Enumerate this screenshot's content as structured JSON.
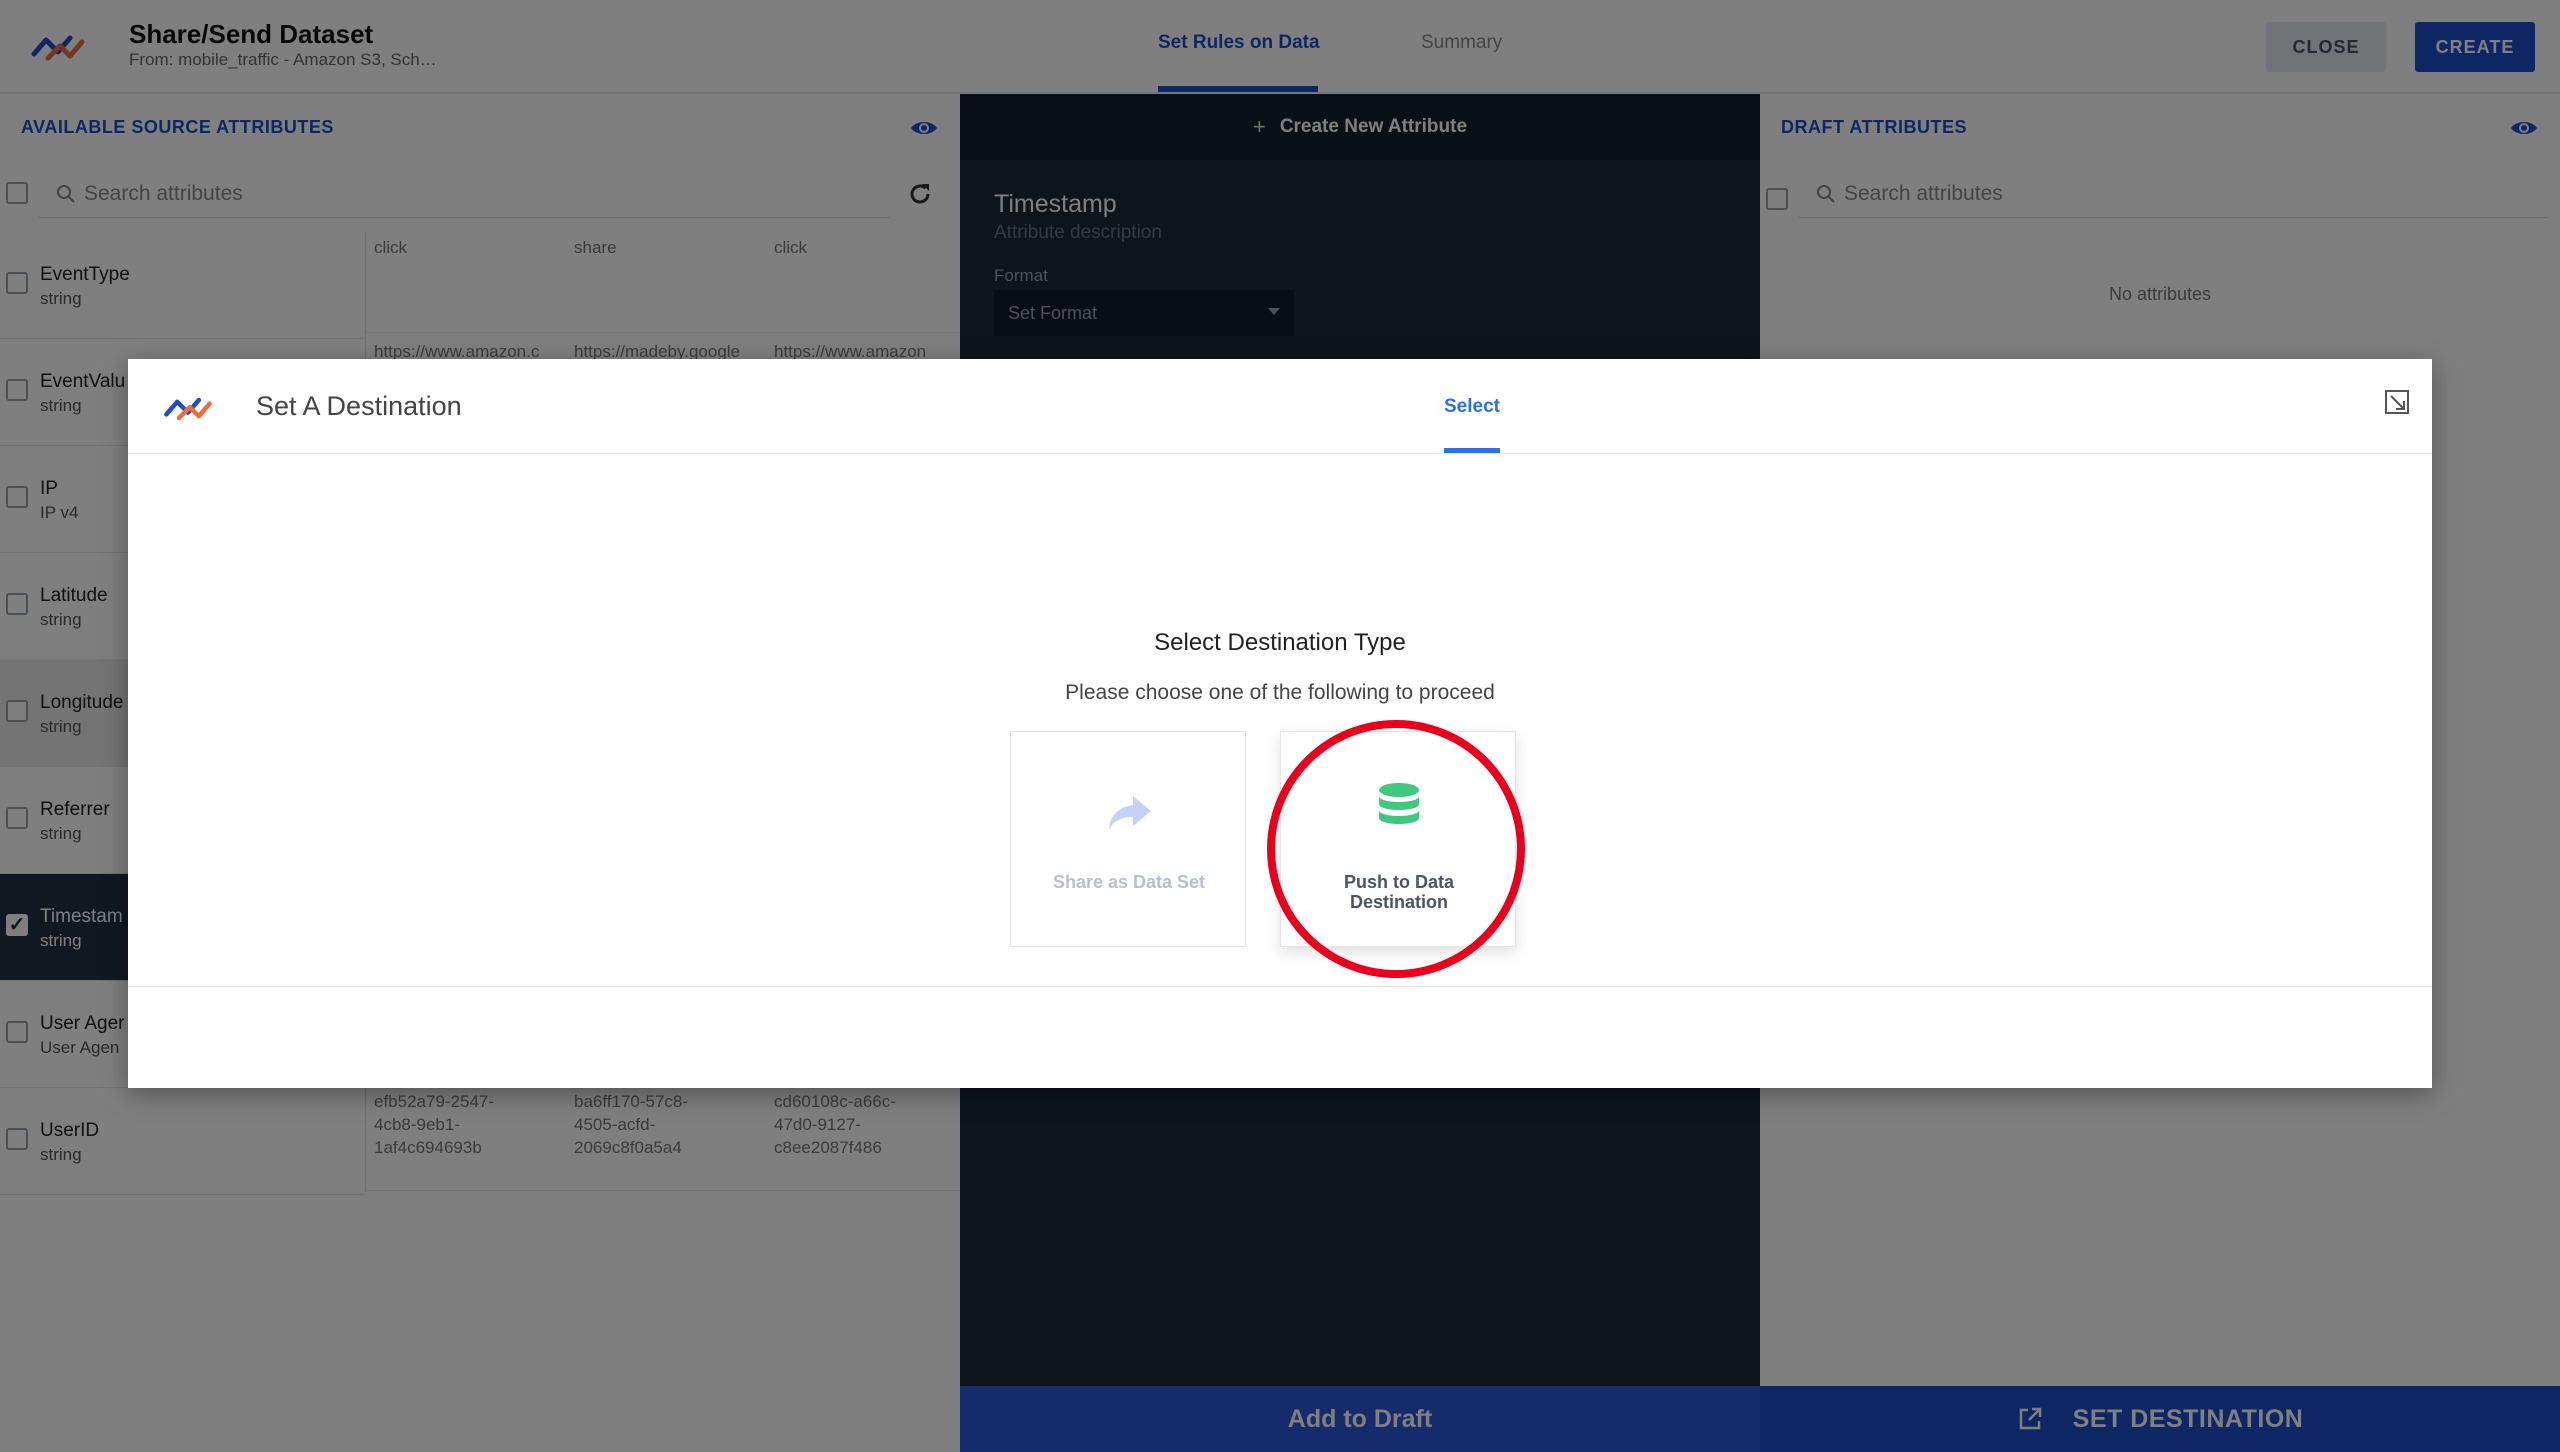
{
  "header": {
    "title": "Share/Send Dataset",
    "subtitle": "From: mobile_traffic - Amazon S3, Sch…",
    "tabs": [
      {
        "label": "Set Rules on Data",
        "active": true
      },
      {
        "label": "Summary",
        "active": false
      }
    ],
    "close_label": "CLOSE",
    "create_label": "CREATE"
  },
  "left_panel": {
    "title": "AVAILABLE SOURCE ATTRIBUTES",
    "search_placeholder": "Search attributes",
    "attributes": [
      {
        "name": "EventType",
        "type": "string"
      },
      {
        "name": "EventValu",
        "type": "string"
      },
      {
        "name": "IP",
        "type": "IP v4"
      },
      {
        "name": "Latitude",
        "type": "string"
      },
      {
        "name": "Longitude",
        "type": "string"
      },
      {
        "name": "Referrer",
        "type": "string"
      },
      {
        "name": "Timestam",
        "type": "string",
        "selected": true
      },
      {
        "name": "User Ager",
        "type": "User Agen"
      },
      {
        "name": "UserID",
        "type": "string"
      }
    ],
    "samples": {
      "row_eventtype": [
        "click",
        "share",
        "click"
      ],
      "row_eventvalue": [
        "https://www.amazon.c",
        "https://madeby.google",
        "https://www.amazon"
      ],
      "row_userid": [
        [
          "efb52a79-2547-",
          "4cb8-9eb1-",
          "1af4c694693b"
        ],
        [
          "ba6ff170-57c8-",
          "4505-acfd-",
          "2069c8f0a5a4"
        ],
        [
          "cd60108c-a66c-",
          "47d0-9127-",
          "c8ee2087f486"
        ]
      ]
    }
  },
  "middle_panel": {
    "create_label": "Create New Attribute",
    "attribute_title": "Timestamp",
    "attribute_description": "Attribute description",
    "format_label": "Format",
    "format_value": "Set Format",
    "add_to_draft_label": "Add to Draft"
  },
  "right_panel": {
    "title": "DRAFT ATTRIBUTES",
    "search_placeholder": "Search attributes",
    "empty_text": "No attributes",
    "set_destination_label": "SET DESTINATION"
  },
  "modal": {
    "title": "Set A Destination",
    "tab_label": "Select",
    "heading": "Select Destination Type",
    "subheading": "Please choose one of the following to proceed",
    "options": [
      {
        "label": "Share as Data Set",
        "icon": "share-arrow-icon",
        "enabled": false
      },
      {
        "label": "Push to Data Destination",
        "icon": "database-icon",
        "enabled": true
      }
    ]
  },
  "colors": {
    "brand_blue": "#1d4fc9",
    "accent_green": "#3ec97f",
    "highlight_red": "#e8001c",
    "dark_panel": "#1f2937"
  }
}
